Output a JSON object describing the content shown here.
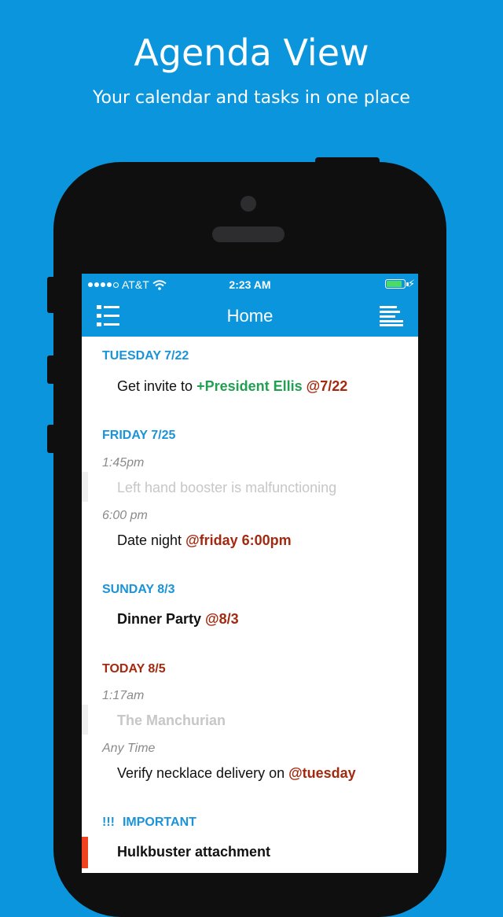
{
  "promo": {
    "title": "Agenda View",
    "subtitle": "Your calendar and tasks in one place"
  },
  "status_bar": {
    "carrier": "AT&T",
    "time": "2:23 AM",
    "signal_icon": "signal-dots-icon",
    "wifi_icon": "wifi-icon",
    "battery_icon": "battery-icon",
    "charging_icon": "charging-bolt-icon"
  },
  "nav": {
    "title": "Home",
    "left_icon": "list-menu-icon",
    "right_icon": "sort-lines-icon"
  },
  "colors": {
    "accent": "#0b95dc",
    "section_blue": "#1a93d8",
    "date_tag": "#a3290f",
    "person_tag": "#22a052",
    "important_bar": "#f0421c"
  },
  "agenda": {
    "tuesday": {
      "header": "TUESDAY 7/22",
      "task_text": "Get invite to ",
      "task_person": "+President Ellis",
      "task_date": "@7/22"
    },
    "friday": {
      "header": "FRIDAY 7/25",
      "time1": "1:45pm",
      "task1": "Left hand booster is malfunctioning",
      "time2": "6:00 pm",
      "task2_text": "Date night ",
      "task2_date": "@friday 6:00pm"
    },
    "sunday": {
      "header": "SUNDAY 8/3",
      "task_text": "Dinner Party ",
      "task_date": "@8/3"
    },
    "today": {
      "header": "TODAY 8/5",
      "time1": "1:17am",
      "task1": "The Manchurian",
      "time2": "Any Time",
      "task2_text": "Verify necklace delivery on ",
      "task2_date": "@tuesday"
    },
    "important": {
      "bang": "!!!",
      "header": "IMPORTANT",
      "task": "Hulkbuster attachment"
    }
  }
}
